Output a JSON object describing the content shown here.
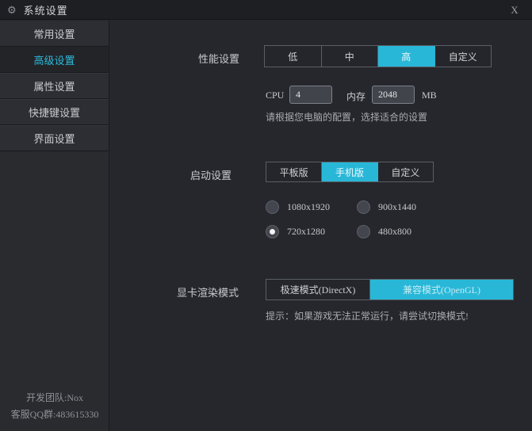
{
  "window": {
    "title": "系统设置",
    "close_glyph": "X",
    "gear_glyph": "⚙"
  },
  "colors": {
    "accent": "#29b7d8",
    "background": "#26272c",
    "titlebar": "#1d1f23"
  },
  "sidebar": {
    "items": [
      {
        "label": "常用设置"
      },
      {
        "label": "高级设置"
      },
      {
        "label": "属性设置"
      },
      {
        "label": "快捷键设置"
      },
      {
        "label": "界面设置"
      }
    ],
    "active_item": "高级设置",
    "footer_line1": "开发团队:Nox",
    "footer_line2": "客服QQ群:483615330"
  },
  "performance": {
    "label": "性能设置",
    "options": [
      "低",
      "中",
      "高",
      "自定义"
    ],
    "selected": "高",
    "cpu_label": "CPU",
    "cpu_value": "4",
    "memory_label": "内存",
    "memory_value": "2048",
    "memory_unit": "MB",
    "hint": "请根据您电脑的配置，选择适合的设置"
  },
  "startup": {
    "label": "启动设置",
    "options": [
      "平板版",
      "手机版",
      "自定义"
    ],
    "selected": "手机版",
    "resolutions": [
      {
        "label": "1080x1920",
        "selected": false
      },
      {
        "label": "900x1440",
        "selected": false
      },
      {
        "label": "720x1280",
        "selected": true
      },
      {
        "label": "480x800",
        "selected": false
      }
    ]
  },
  "graphics": {
    "label": "显卡渲染模式",
    "options": [
      "极速模式(DirectX)",
      "兼容模式(OpenGL)"
    ],
    "selected": "兼容模式(OpenGL)",
    "hint": "提示：如果游戏无法正常运行，请尝试切换模式!"
  }
}
